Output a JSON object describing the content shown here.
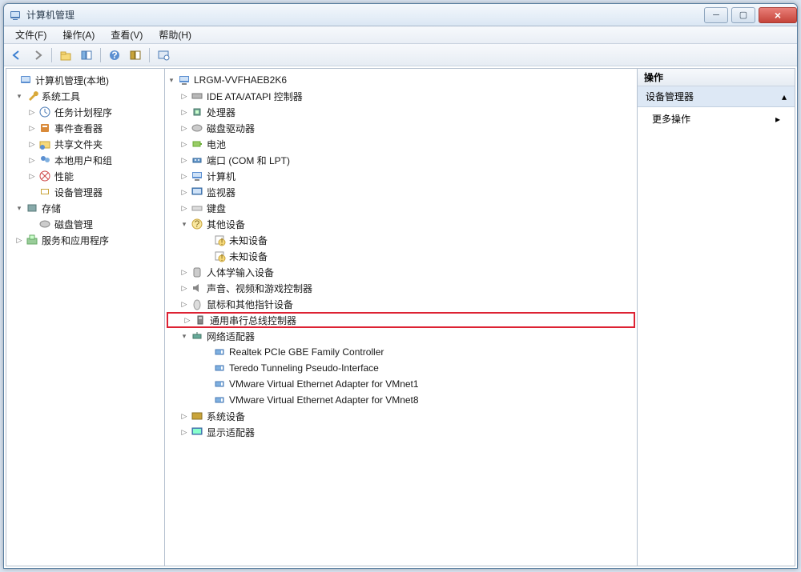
{
  "window": {
    "title": "计算机管理"
  },
  "menus": {
    "file": "文件(F)",
    "action": "操作(A)",
    "view": "查看(V)",
    "help": "帮助(H)"
  },
  "toolbar_icons": [
    "back",
    "forward",
    "up",
    "show-hide",
    "help",
    "properties",
    "refresh"
  ],
  "left_tree": {
    "root": {
      "label": "计算机管理(本地)",
      "icon": "computer-mgmt"
    },
    "system_tools": {
      "label": "系统工具",
      "icon": "wrench",
      "children": [
        {
          "label": "任务计划程序",
          "icon": "clock"
        },
        {
          "label": "事件查看器",
          "icon": "event"
        },
        {
          "label": "共享文件夹",
          "icon": "share"
        },
        {
          "label": "本地用户和组",
          "icon": "users"
        },
        {
          "label": "性能",
          "icon": "perf"
        },
        {
          "label": "设备管理器",
          "icon": "device"
        }
      ]
    },
    "storage": {
      "label": "存储",
      "icon": "storage",
      "children": [
        {
          "label": "磁盘管理",
          "icon": "disk"
        }
      ]
    },
    "services": {
      "label": "服务和应用程序",
      "icon": "services"
    }
  },
  "device_tree": {
    "root": "LRGM-VVFHAEB2K6",
    "items": [
      {
        "label": "IDE ATA/ATAPI 控制器",
        "icon": "ide",
        "expanded": false
      },
      {
        "label": "处理器",
        "icon": "cpu",
        "expanded": false
      },
      {
        "label": "磁盘驱动器",
        "icon": "disk",
        "expanded": false
      },
      {
        "label": "电池",
        "icon": "battery",
        "expanded": false
      },
      {
        "label": "端口 (COM 和 LPT)",
        "icon": "port",
        "expanded": false
      },
      {
        "label": "计算机",
        "icon": "computer",
        "expanded": false
      },
      {
        "label": "监视器",
        "icon": "monitor",
        "expanded": false
      },
      {
        "label": "键盘",
        "icon": "keyboard",
        "expanded": false
      },
      {
        "label": "其他设备",
        "icon": "other",
        "expanded": true,
        "children": [
          {
            "label": "未知设备",
            "icon": "unknown"
          },
          {
            "label": "未知设备",
            "icon": "unknown"
          }
        ]
      },
      {
        "label": "人体学输入设备",
        "icon": "hid",
        "expanded": false
      },
      {
        "label": "声音、视频和游戏控制器",
        "icon": "sound",
        "expanded": false
      },
      {
        "label": "鼠标和其他指针设备",
        "icon": "mouse",
        "expanded": false
      },
      {
        "label": "通用串行总线控制器",
        "icon": "usb",
        "expanded": false,
        "highlight": true
      },
      {
        "label": "网络适配器",
        "icon": "network",
        "expanded": true,
        "children": [
          {
            "label": "Realtek PCIe GBE Family Controller",
            "icon": "nic"
          },
          {
            "label": "Teredo Tunneling Pseudo-Interface",
            "icon": "nic"
          },
          {
            "label": "VMware Virtual Ethernet Adapter for VMnet1",
            "icon": "nic"
          },
          {
            "label": "VMware Virtual Ethernet Adapter for VMnet8",
            "icon": "nic"
          }
        ]
      },
      {
        "label": "系统设备",
        "icon": "system",
        "expanded": false
      },
      {
        "label": "显示适配器",
        "icon": "display",
        "expanded": false
      }
    ]
  },
  "actions_panel": {
    "header": "操作",
    "section": "设备管理器",
    "more": "更多操作"
  }
}
